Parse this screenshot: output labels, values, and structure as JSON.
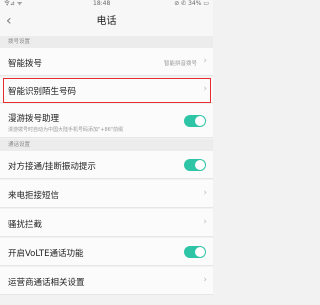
{
  "status_bar": {
    "left": "令⊿ ᯤ",
    "time": "18:48",
    "right": "⊘ ✆ 34% ▭"
  },
  "header": {
    "title": "电话"
  },
  "sections": [
    {
      "title": "拨号设置",
      "rows": [
        {
          "label": "智能拨号",
          "value": "智能拼音拨号",
          "control": "chevron"
        },
        {
          "label": "智能识别陌生号码",
          "control": "chevron",
          "highlighted": true
        },
        {
          "label": "漫游拨号助理",
          "sublabel": "漫游拨号时自动为中国大陆手机号码添加\"+86\"前缀",
          "control": "toggle",
          "toggle_on": true
        }
      ]
    },
    {
      "title": "通话设置",
      "rows": [
        {
          "label": "对方接通/挂断振动提示",
          "control": "toggle",
          "toggle_on": true
        },
        {
          "label": "来电拒接短信",
          "control": "chevron"
        },
        {
          "label": "骚扰拦截",
          "control": "chevron"
        },
        {
          "label": "开启VoLTE通话功能",
          "control": "toggle",
          "toggle_on": true
        },
        {
          "label": "运营商通话相关设置",
          "control": "chevron"
        }
      ]
    }
  ],
  "colors": {
    "toggle_on": "#2ec4a6",
    "highlight": "#e62e2e"
  }
}
